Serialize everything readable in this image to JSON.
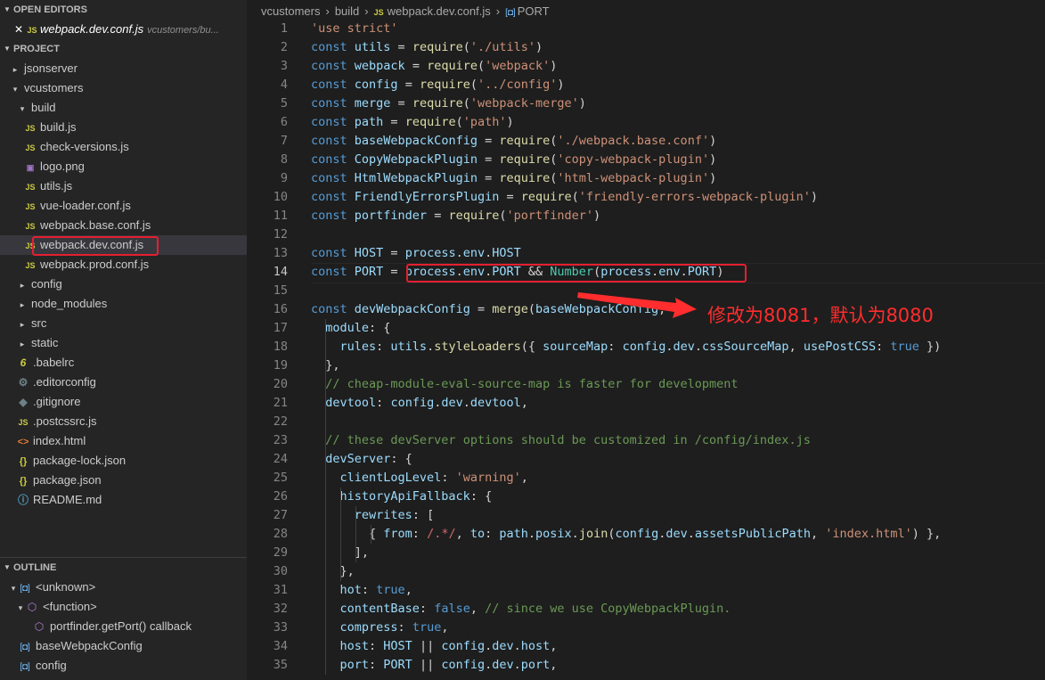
{
  "sidebar": {
    "open_editors_title": "OPEN EDITORS",
    "open_editor": {
      "close_glyph": "✕",
      "icon": "JS",
      "name": "webpack.dev.conf.js",
      "path": "vcustomers/bu..."
    },
    "project_title": "PROJECT",
    "tree": [
      {
        "label": "jsonserver",
        "type": "folder",
        "open": false,
        "level": 0
      },
      {
        "label": "vcustomers",
        "type": "folder",
        "open": true,
        "level": 0
      },
      {
        "label": "build",
        "type": "folder",
        "open": true,
        "level": 1
      },
      {
        "label": "build.js",
        "type": "js",
        "level": 2
      },
      {
        "label": "check-versions.js",
        "type": "js",
        "level": 2
      },
      {
        "label": "logo.png",
        "type": "png",
        "level": 2
      },
      {
        "label": "utils.js",
        "type": "js",
        "level": 2
      },
      {
        "label": "vue-loader.conf.js",
        "type": "js",
        "level": 2
      },
      {
        "label": "webpack.base.conf.js",
        "type": "js",
        "level": 2
      },
      {
        "label": "webpack.dev.conf.js",
        "type": "js",
        "level": 2,
        "selected": true
      },
      {
        "label": "webpack.prod.conf.js",
        "type": "js",
        "level": 2
      },
      {
        "label": "config",
        "type": "folder",
        "open": false,
        "level": 1
      },
      {
        "label": "node_modules",
        "type": "folder",
        "open": false,
        "level": 1
      },
      {
        "label": "src",
        "type": "folder",
        "open": false,
        "level": 1
      },
      {
        "label": "static",
        "type": "folder",
        "open": false,
        "level": 1
      },
      {
        "label": ".babelrc",
        "type": "babel",
        "level": 1
      },
      {
        "label": ".editorconfig",
        "type": "gear",
        "level": 1
      },
      {
        "label": ".gitignore",
        "type": "git",
        "level": 1
      },
      {
        "label": ".postcssrc.js",
        "type": "js",
        "level": 1
      },
      {
        "label": "index.html",
        "type": "html",
        "level": 1
      },
      {
        "label": "package-lock.json",
        "type": "json",
        "level": 1
      },
      {
        "label": "package.json",
        "type": "json",
        "level": 1
      },
      {
        "label": "README.md",
        "type": "info",
        "level": 1
      }
    ],
    "outline_title": "OUTLINE",
    "outline": [
      {
        "label": "<unknown>",
        "kind": "variable",
        "level": 0,
        "open": true
      },
      {
        "label": "<function>",
        "kind": "function",
        "level": 1,
        "open": true
      },
      {
        "label": "portfinder.getPort() callback",
        "kind": "function",
        "level": 2
      },
      {
        "label": "baseWebpackConfig",
        "kind": "variable",
        "level": 0
      },
      {
        "label": "config",
        "kind": "variable",
        "level": 0
      }
    ]
  },
  "icons": {
    "js": "JS",
    "png": "▣",
    "babel": "6",
    "gear": "⚙",
    "git": "◆",
    "html": "<>",
    "json": "{}",
    "info": "ⓘ",
    "folder_closed": "▸",
    "folder_open": "▾",
    "variable": "[◘]",
    "function": "⬡"
  },
  "breadcrumb": [
    "vcustomers",
    "build",
    "webpack.dev.conf.js",
    "PORT"
  ],
  "breadcrumb_sep": "›",
  "editor": {
    "current_line": 14,
    "lines": [
      [
        [
          "str",
          "'use strict'"
        ]
      ],
      [
        [
          "kw",
          "const "
        ],
        [
          "var",
          "utils"
        ],
        [
          "p",
          " = "
        ],
        [
          "fn",
          "require"
        ],
        [
          "p",
          "("
        ],
        [
          "str",
          "'./utils'"
        ],
        [
          "p",
          ")"
        ]
      ],
      [
        [
          "kw",
          "const "
        ],
        [
          "var",
          "webpack"
        ],
        [
          "p",
          " = "
        ],
        [
          "fn",
          "require"
        ],
        [
          "p",
          "("
        ],
        [
          "str",
          "'webpack'"
        ],
        [
          "p",
          ")"
        ]
      ],
      [
        [
          "kw",
          "const "
        ],
        [
          "var",
          "config"
        ],
        [
          "p",
          " = "
        ],
        [
          "fn",
          "require"
        ],
        [
          "p",
          "("
        ],
        [
          "str",
          "'../config'"
        ],
        [
          "p",
          ")"
        ]
      ],
      [
        [
          "kw",
          "const "
        ],
        [
          "var",
          "merge"
        ],
        [
          "p",
          " = "
        ],
        [
          "fn",
          "require"
        ],
        [
          "p",
          "("
        ],
        [
          "str",
          "'webpack-merge'"
        ],
        [
          "p",
          ")"
        ]
      ],
      [
        [
          "kw",
          "const "
        ],
        [
          "var",
          "path"
        ],
        [
          "p",
          " = "
        ],
        [
          "fn",
          "require"
        ],
        [
          "p",
          "("
        ],
        [
          "str",
          "'path'"
        ],
        [
          "p",
          ")"
        ]
      ],
      [
        [
          "kw",
          "const "
        ],
        [
          "var",
          "baseWebpackConfig"
        ],
        [
          "p",
          " = "
        ],
        [
          "fn",
          "require"
        ],
        [
          "p",
          "("
        ],
        [
          "str",
          "'./webpack.base.conf'"
        ],
        [
          "p",
          ")"
        ]
      ],
      [
        [
          "kw",
          "const "
        ],
        [
          "var",
          "CopyWebpackPlugin"
        ],
        [
          "p",
          " = "
        ],
        [
          "fn",
          "require"
        ],
        [
          "p",
          "("
        ],
        [
          "str",
          "'copy-webpack-plugin'"
        ],
        [
          "p",
          ")"
        ]
      ],
      [
        [
          "kw",
          "const "
        ],
        [
          "var",
          "HtmlWebpackPlugin"
        ],
        [
          "p",
          " = "
        ],
        [
          "fn",
          "require"
        ],
        [
          "p",
          "("
        ],
        [
          "str",
          "'html-webpack-plugin'"
        ],
        [
          "p",
          ")"
        ]
      ],
      [
        [
          "kw",
          "const "
        ],
        [
          "var",
          "FriendlyErrorsPlugin"
        ],
        [
          "p",
          " = "
        ],
        [
          "fn",
          "require"
        ],
        [
          "p",
          "("
        ],
        [
          "str",
          "'friendly-errors-webpack-plugin'"
        ],
        [
          "p",
          ")"
        ]
      ],
      [
        [
          "kw",
          "const "
        ],
        [
          "var",
          "portfinder"
        ],
        [
          "p",
          " = "
        ],
        [
          "fn",
          "require"
        ],
        [
          "p",
          "("
        ],
        [
          "str",
          "'portfinder'"
        ],
        [
          "p",
          ")"
        ]
      ],
      [],
      [
        [
          "kw",
          "const "
        ],
        [
          "var",
          "HOST"
        ],
        [
          "p",
          " = "
        ],
        [
          "var",
          "process"
        ],
        [
          "p",
          "."
        ],
        [
          "var",
          "env"
        ],
        [
          "p",
          "."
        ],
        [
          "var",
          "HOST"
        ]
      ],
      [
        [
          "kw",
          "const "
        ],
        [
          "var",
          "PORT"
        ],
        [
          "p",
          " = "
        ],
        [
          "var",
          "process"
        ],
        [
          "p",
          "."
        ],
        [
          "var",
          "env"
        ],
        [
          "p",
          "."
        ],
        [
          "var",
          "PORT"
        ],
        [
          "p",
          " && "
        ],
        [
          "cls",
          "Number"
        ],
        [
          "p",
          "("
        ],
        [
          "var",
          "process"
        ],
        [
          "p",
          "."
        ],
        [
          "var",
          "env"
        ],
        [
          "p",
          "."
        ],
        [
          "var",
          "PORT"
        ],
        [
          "p",
          ")"
        ]
      ],
      [],
      [
        [
          "kw",
          "const "
        ],
        [
          "var",
          "devWebpackConfig"
        ],
        [
          "p",
          " = "
        ],
        [
          "fn",
          "merge"
        ],
        [
          "p",
          "("
        ],
        [
          "var",
          "baseWebpackConfig"
        ],
        [
          "p",
          ", {"
        ]
      ],
      [
        [
          "p",
          "  "
        ],
        [
          "var",
          "module"
        ],
        [
          "p",
          ": {"
        ]
      ],
      [
        [
          "p",
          "    "
        ],
        [
          "var",
          "rules"
        ],
        [
          "p",
          ": "
        ],
        [
          "var",
          "utils"
        ],
        [
          "p",
          "."
        ],
        [
          "fn",
          "styleLoaders"
        ],
        [
          "p",
          "({ "
        ],
        [
          "var",
          "sourceMap"
        ],
        [
          "p",
          ": "
        ],
        [
          "var",
          "config"
        ],
        [
          "p",
          "."
        ],
        [
          "var",
          "dev"
        ],
        [
          "p",
          "."
        ],
        [
          "var",
          "cssSourceMap"
        ],
        [
          "p",
          ", "
        ],
        [
          "var",
          "usePostCSS"
        ],
        [
          "p",
          ": "
        ],
        [
          "kw",
          "true"
        ],
        [
          "p",
          " })"
        ]
      ],
      [
        [
          "p",
          "  },"
        ]
      ],
      [
        [
          "p",
          "  "
        ],
        [
          "cm",
          "// cheap-module-eval-source-map is faster for development"
        ]
      ],
      [
        [
          "p",
          "  "
        ],
        [
          "var",
          "devtool"
        ],
        [
          "p",
          ": "
        ],
        [
          "var",
          "config"
        ],
        [
          "p",
          "."
        ],
        [
          "var",
          "dev"
        ],
        [
          "p",
          "."
        ],
        [
          "var",
          "devtool"
        ],
        [
          "p",
          ","
        ]
      ],
      [],
      [
        [
          "p",
          "  "
        ],
        [
          "cm",
          "// these devServer options should be customized in /config/index.js"
        ]
      ],
      [
        [
          "p",
          "  "
        ],
        [
          "var",
          "devServer"
        ],
        [
          "p",
          ": {"
        ]
      ],
      [
        [
          "p",
          "    "
        ],
        [
          "var",
          "clientLogLevel"
        ],
        [
          "p",
          ": "
        ],
        [
          "str",
          "'warning'"
        ],
        [
          "p",
          ","
        ]
      ],
      [
        [
          "p",
          "    "
        ],
        [
          "var",
          "historyApiFallback"
        ],
        [
          "p",
          ": {"
        ]
      ],
      [
        [
          "p",
          "      "
        ],
        [
          "var",
          "rewrites"
        ],
        [
          "p",
          ": ["
        ]
      ],
      [
        [
          "p",
          "        { "
        ],
        [
          "var",
          "from"
        ],
        [
          "p",
          ": "
        ],
        [
          "rx",
          "/.*/"
        ],
        [
          "p",
          ", "
        ],
        [
          "var",
          "to"
        ],
        [
          "p",
          ": "
        ],
        [
          "var",
          "path"
        ],
        [
          "p",
          "."
        ],
        [
          "var",
          "posix"
        ],
        [
          "p",
          "."
        ],
        [
          "fn",
          "join"
        ],
        [
          "p",
          "("
        ],
        [
          "var",
          "config"
        ],
        [
          "p",
          "."
        ],
        [
          "var",
          "dev"
        ],
        [
          "p",
          "."
        ],
        [
          "var",
          "assetsPublicPath"
        ],
        [
          "p",
          ", "
        ],
        [
          "str",
          "'index.html'"
        ],
        [
          "p",
          ") },"
        ]
      ],
      [
        [
          "p",
          "      ],"
        ]
      ],
      [
        [
          "p",
          "    },"
        ]
      ],
      [
        [
          "p",
          "    "
        ],
        [
          "var",
          "hot"
        ],
        [
          "p",
          ": "
        ],
        [
          "kw",
          "true"
        ],
        [
          "p",
          ","
        ]
      ],
      [
        [
          "p",
          "    "
        ],
        [
          "var",
          "contentBase"
        ],
        [
          "p",
          ": "
        ],
        [
          "kw",
          "false"
        ],
        [
          "p",
          ", "
        ],
        [
          "cm",
          "// since we use CopyWebpackPlugin."
        ]
      ],
      [
        [
          "p",
          "    "
        ],
        [
          "var",
          "compress"
        ],
        [
          "p",
          ": "
        ],
        [
          "kw",
          "true"
        ],
        [
          "p",
          ","
        ]
      ],
      [
        [
          "p",
          "    "
        ],
        [
          "var",
          "host"
        ],
        [
          "p",
          ": "
        ],
        [
          "var",
          "HOST"
        ],
        [
          "p",
          " || "
        ],
        [
          "var",
          "config"
        ],
        [
          "p",
          "."
        ],
        [
          "var",
          "dev"
        ],
        [
          "p",
          "."
        ],
        [
          "var",
          "host"
        ],
        [
          "p",
          ","
        ]
      ],
      [
        [
          "p",
          "    "
        ],
        [
          "var",
          "port"
        ],
        [
          "p",
          ": "
        ],
        [
          "var",
          "PORT"
        ],
        [
          "p",
          " || "
        ],
        [
          "var",
          "config"
        ],
        [
          "p",
          "."
        ],
        [
          "var",
          "dev"
        ],
        [
          "p",
          "."
        ],
        [
          "var",
          "port"
        ],
        [
          "p",
          ","
        ]
      ]
    ]
  },
  "annotation": {
    "text": "修改为8081，默认为8080",
    "color": "#ff2d2d"
  },
  "colors": {
    "highlight": "#e51f30",
    "selection": "#37373d",
    "sidebar_bg": "#252526",
    "editor_bg": "#1e1e1e"
  }
}
